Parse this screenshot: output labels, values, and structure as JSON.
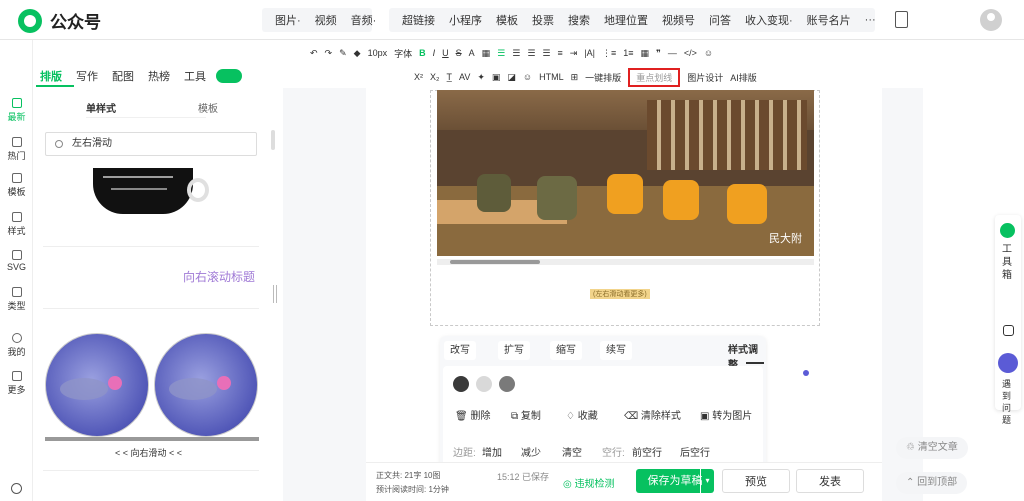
{
  "app": {
    "title": "公众号"
  },
  "topnav1": [
    "图片·",
    "视频",
    "音频·"
  ],
  "topnav2": [
    "超链接",
    "小程序",
    "模板",
    "投票",
    "搜索",
    "地理位置",
    "视频号",
    "问答",
    "收入变现·",
    "账号名片",
    "···"
  ],
  "editor_tabs": {
    "layout": "排版",
    "write": "写作",
    "image": "配图",
    "hot": "热榜",
    "tools": "工具"
  },
  "toolbar1": {
    "font_size": "10px",
    "font": "字体"
  },
  "toolbar2": {
    "one_key": "一键排版",
    "highlight": "重点划线",
    "image_design": "图片设计",
    "ai": "AI排版"
  },
  "left_rail": [
    "最新",
    "热门",
    "模板",
    "样式",
    "SVG",
    "类型",
    "我的",
    "更多"
  ],
  "panel": {
    "tab_single": "单样式",
    "tab_template": "模板",
    "search_value": "左右滑动",
    "purple_title": "向右滚动标题",
    "scroll_label": "< < 向右滑动 < <"
  },
  "canvas": {
    "slide_hint": "(左右滑动看更多)",
    "photo_watermark": "民大附"
  },
  "ai": {
    "rewrite": "改写",
    "expand": "扩写",
    "shrink": "缩写",
    "continue": "续写",
    "style_adjust": "样式调整",
    "delete": "删除",
    "copy": "复制",
    "collect": "收藏",
    "clear_style": "清除样式",
    "to_image": "转为图片",
    "margin": "边距:",
    "add": "增加",
    "reduce": "减少",
    "clear": "清空",
    "blank_row": "空行:",
    "before_row": "前空行",
    "after_row": "后空行"
  },
  "colors": {
    "dot1": "#3a3a3a",
    "dot2": "#d9d9d9",
    "dot3": "#7a7a7a",
    "green": "#07c160"
  },
  "bottom": {
    "word_count": "正文共: 21字 10图",
    "read_time": "预计阅读时间: 1分钟",
    "saved": "15:12 已保存",
    "check": "违规检测",
    "save_draft": "保存为草稿",
    "preview": "预览",
    "publish": "发表"
  },
  "right": {
    "toolbox": "工具箱",
    "issue": "遇到问题",
    "clear_article": "清空文章",
    "back_top": "回到顶部"
  }
}
